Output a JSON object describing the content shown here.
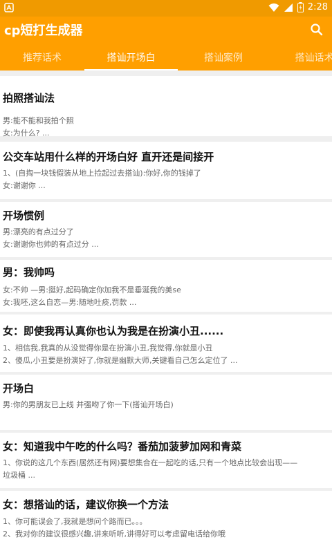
{
  "status": {
    "time": "2:28"
  },
  "app": {
    "title": "cp短打生成器"
  },
  "tabs": [
    {
      "label": "推荐话术"
    },
    {
      "label": "搭讪开场白"
    },
    {
      "label": "搭讪案例"
    },
    {
      "label": "搭讪话术"
    }
  ],
  "list": [
    {
      "title": "拍照搭讪法",
      "lines": [
        "男:能不能和我拍个照",
        "女:为什么? ..."
      ]
    },
    {
      "title": "公交车站用什么样的开场白好 直开还是间接开",
      "lines": [
        "1、(自掏一块钱假装从地上捡起过去搭讪):你好,你的钱掉了",
        "女:谢谢你 ..."
      ]
    },
    {
      "title": "开场惯例",
      "lines": [
        "男:漂亮的有点过分了",
        "女:谢谢你也帅的有点过分 ..."
      ]
    },
    {
      "title": "男：我帅吗",
      "lines": [
        "女:不帅 —男:挺好,起码确定你加我不是垂涎我的美se",
        "女:我呸,这么自恋—男:随地吐痰,罚款 ..."
      ]
    },
    {
      "title": "女：即使我再认真你也认为我是在扮演小丑......",
      "lines": [
        "1、相信我,我真的从没觉得你是在扮演小丑,我觉得,你就是小丑",
        "2、傻瓜,小丑要是扮演好了,你就是幽默大师,关键看自己怎么定位了 ..."
      ]
    },
    {
      "title": "开场白",
      "lines": [
        "男:你的男朋友已上线 并强吻了你一下(搭讪开场白)"
      ]
    },
    {
      "title": "女：知道我中午吃的什么吗？番茄加菠萝加网和青菜",
      "lines": [
        "1、你说的这几个东西(居然还有网)要想集合在一起吃的话,只有一个地点比较会出现——",
        "垃圾桶 ..."
      ]
    },
    {
      "title": "女：想搭讪的话，建议你换一个方法",
      "lines": [
        "1、你可能误会了,我就是想问个路而已。。。",
        "2、我对你的建议很感兴趣,讲来听听,讲得好可以考虑留电话给你哦"
      ]
    }
  ]
}
